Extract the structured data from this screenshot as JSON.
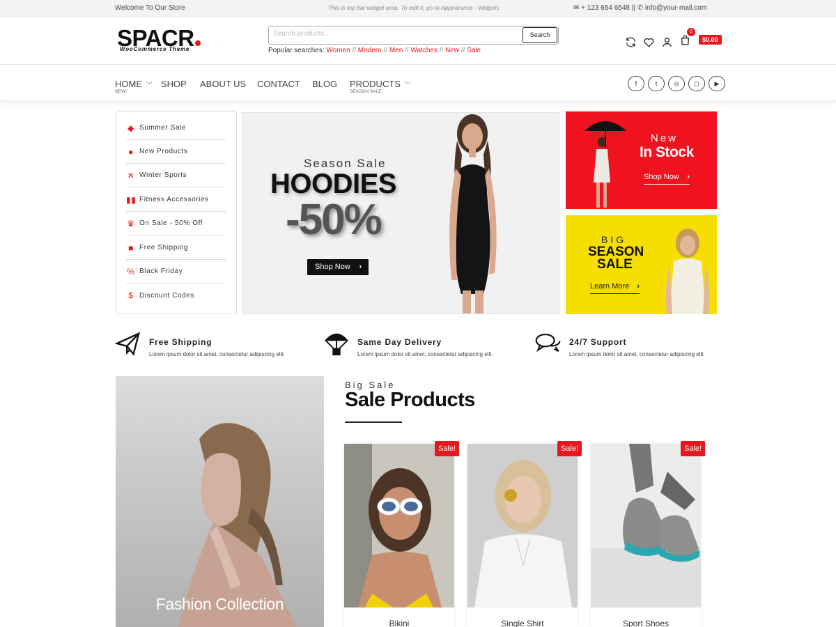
{
  "topbar": {
    "welcome": "Welcome To Our Store",
    "widget_note": "This is top bar widget area. To edit it, go to Appearance - Widgets",
    "phone": "+ 123 654 6548",
    "separator": "||",
    "email": "info@your-mail.com"
  },
  "header": {
    "logo_text": "SPACR",
    "logo_sub": "WooCommerce Theme",
    "search_placeholder": "Search products...",
    "search_button": "Search",
    "popular_label": "Popular searches:",
    "popular_links": [
      "Women",
      "Modern",
      "Men",
      "Watches",
      "New",
      "Sale"
    ],
    "cart_count": "0",
    "cart_total": "$0.00"
  },
  "nav": {
    "items": [
      {
        "label": "HOME",
        "sub": "NEW!"
      },
      {
        "label": "SHOP",
        "sub": ""
      },
      {
        "label": "ABOUT US",
        "sub": ""
      },
      {
        "label": "CONTACT",
        "sub": ""
      },
      {
        "label": "BLOG",
        "sub": ""
      },
      {
        "label": "PRODUCTS",
        "sub": "SEASON SALE!"
      }
    ],
    "socials": [
      "facebook-icon",
      "twitter-icon",
      "dribbble-icon",
      "instagram-icon",
      "youtube-icon"
    ]
  },
  "categories": [
    {
      "label": "Summer Sale",
      "icon": "tag-icon"
    },
    {
      "label": "New Products",
      "icon": "users-icon"
    },
    {
      "label": "Winter Sports",
      "icon": "skier-icon"
    },
    {
      "label": "Fitness Accessories",
      "icon": "dumbbell-icon"
    },
    {
      "label": "On Sale - 50% Off",
      "icon": "crown-icon"
    },
    {
      "label": "Free Shipping",
      "icon": "truck-icon"
    },
    {
      "label": "Black Friday",
      "icon": "percent-icon"
    },
    {
      "label": "Discount Codes",
      "icon": "dollar-icon"
    }
  ],
  "hero": {
    "season": "Season Sale",
    "title": "HOODIES",
    "discount": "-50%",
    "button": "Shop Now"
  },
  "side_banners": {
    "red": {
      "line1": "New",
      "line2": "In Stock",
      "button": "Shop Now"
    },
    "yellow": {
      "line1": "BIG",
      "line2": "SEASON",
      "line3": "SALE",
      "button": "Learn More"
    }
  },
  "features": [
    {
      "title": "Free Shipping",
      "desc": "Lorem ipsum dolor sit amet, consectetur adipiscing elit.",
      "icon": "paper-plane-icon"
    },
    {
      "title": "Same Day Delivery",
      "desc": "Lorem ipsum dolor sit amet, consectetur adipiscing elit.",
      "icon": "parachute-icon"
    },
    {
      "title": "24/7 Support",
      "desc": "Lorem ipsum dolor sit amet, consectetur adipiscing elit.",
      "icon": "chat-icon"
    }
  ],
  "fashion": {
    "label": "Fashion Collection"
  },
  "sale_section": {
    "kicker": "Big Sale",
    "title": "Sale Products",
    "badge": "Sale!",
    "products": [
      {
        "name": "Bikini"
      },
      {
        "name": "Single Shirt"
      },
      {
        "name": "Sport Shoes"
      }
    ]
  },
  "colors": {
    "accent": "#e8171f",
    "yellow": "#f6de00",
    "dark": "#111111"
  }
}
